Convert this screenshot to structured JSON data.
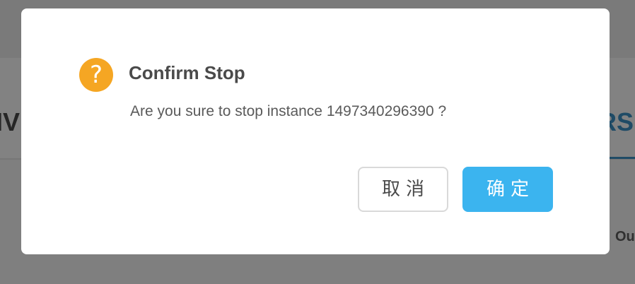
{
  "background": {
    "tab_left": "IV",
    "tab_right": "RS",
    "label_right": "Ou"
  },
  "dialog": {
    "icon": "question-circle-icon",
    "icon_glyph": "?",
    "icon_color": "#f5a623",
    "title": "Confirm Stop",
    "message": "Are you sure to stop instance 1497340296390 ?",
    "cancel_label": "取消",
    "ok_label": "确定",
    "ok_color": "#3bb4ef"
  }
}
